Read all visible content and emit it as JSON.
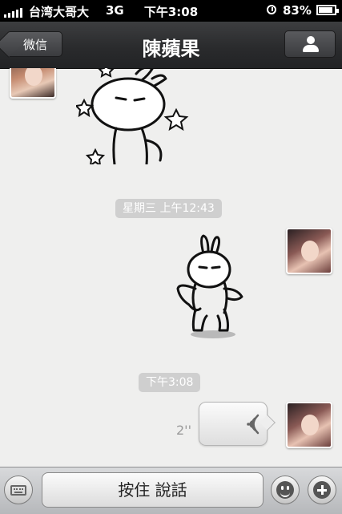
{
  "status_bar": {
    "carrier": "台湾大哥大",
    "network": "3G",
    "time": "下午3:08",
    "battery": "83%"
  },
  "nav": {
    "back_label": "微信",
    "title": "陳蘋果"
  },
  "chat": {
    "timestamps": [
      "星期三 上午12:43",
      "下午3:08"
    ],
    "voice_duration": "2''"
  },
  "input_bar": {
    "hold_to_talk": "按住 說話"
  },
  "colors": {
    "nav_bar": "#2a2b2d",
    "chat_background": "#efefee",
    "timestamp_pill": "#cfcfcf"
  }
}
